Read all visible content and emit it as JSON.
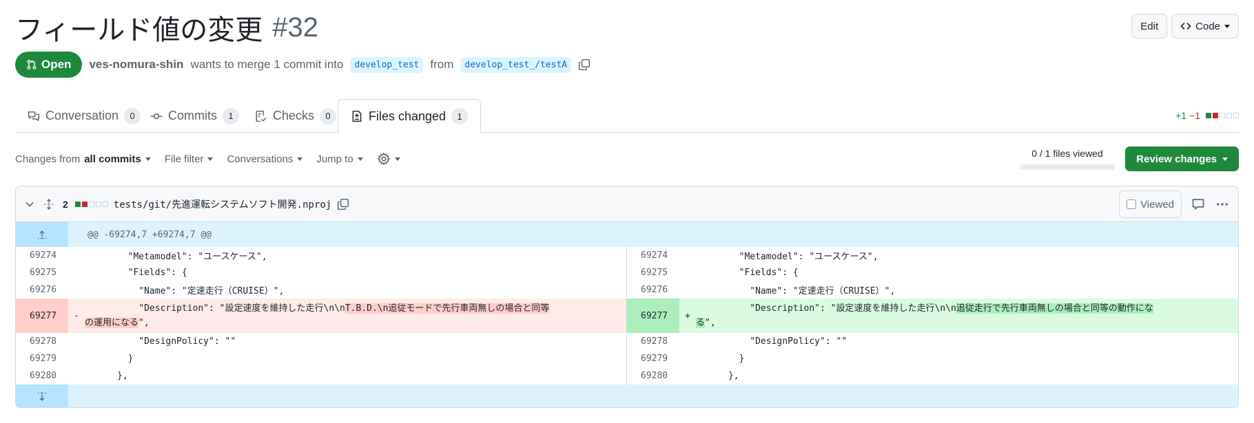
{
  "header": {
    "title": "フィールド値の変更",
    "number": "#32",
    "edit_label": "Edit",
    "code_label": "Code"
  },
  "meta": {
    "state": "Open",
    "author": "ves-nomura-shin",
    "text": "wants to merge 1 commit into",
    "base_branch": "develop_test",
    "from_text": "from",
    "head_branch": "develop_test_/testA"
  },
  "tabs": [
    {
      "label": "Conversation",
      "count": "0"
    },
    {
      "label": "Commits",
      "count": "1"
    },
    {
      "label": "Checks",
      "count": "0"
    },
    {
      "label": "Files changed",
      "count": "1"
    }
  ],
  "diffstat": {
    "additions": "+1",
    "deletions": "−1"
  },
  "toolbar": {
    "changes_from": "Changes from",
    "all_commits": "all commits",
    "file_filter": "File filter",
    "conversations": "Conversations",
    "jump_to": "Jump to",
    "files_viewed": "0 / 1 files viewed",
    "review_changes": "Review changes"
  },
  "file": {
    "changes": "2",
    "path": "tests/git/先進運転システムソフト開発.nproj",
    "viewed_label": "Viewed"
  },
  "diff": {
    "hunk_header": "@@ -69274,7 +69274,7 @@",
    "ctx1": {
      "ln": "69274",
      "code": "        \"Metamodel\": \"ユースケース\","
    },
    "ctx2": {
      "ln": "69275",
      "code": "        \"Fields\": {"
    },
    "ctx3": {
      "ln": "69276",
      "code": "          \"Name\": \"定速走行（CRUISE）\","
    },
    "del": {
      "ln": "69277",
      "sign": "-",
      "prefix": "          \"Description\": \"設定速度を維持した走行\\n\\n",
      "changed": "T.B.D.\\n追従モードで先行車両無しの場合と同等",
      "wrap_changed": "の運用になる",
      "suffix": "\","
    },
    "add": {
      "ln": "69277",
      "sign": "+",
      "prefix": "          \"Description\": \"設定速度を維持した走行\\n\\n",
      "changed": "追従走行で先行車両無しの場合と同等の動作にな",
      "wrap_changed": "る",
      "suffix": "\","
    },
    "ctx4": {
      "ln": "69278",
      "code": "          \"DesignPolicy\": \"\""
    },
    "ctx5": {
      "ln": "69279",
      "code": "        }"
    },
    "ctx6": {
      "ln": "69280",
      "code": "      },"
    }
  }
}
